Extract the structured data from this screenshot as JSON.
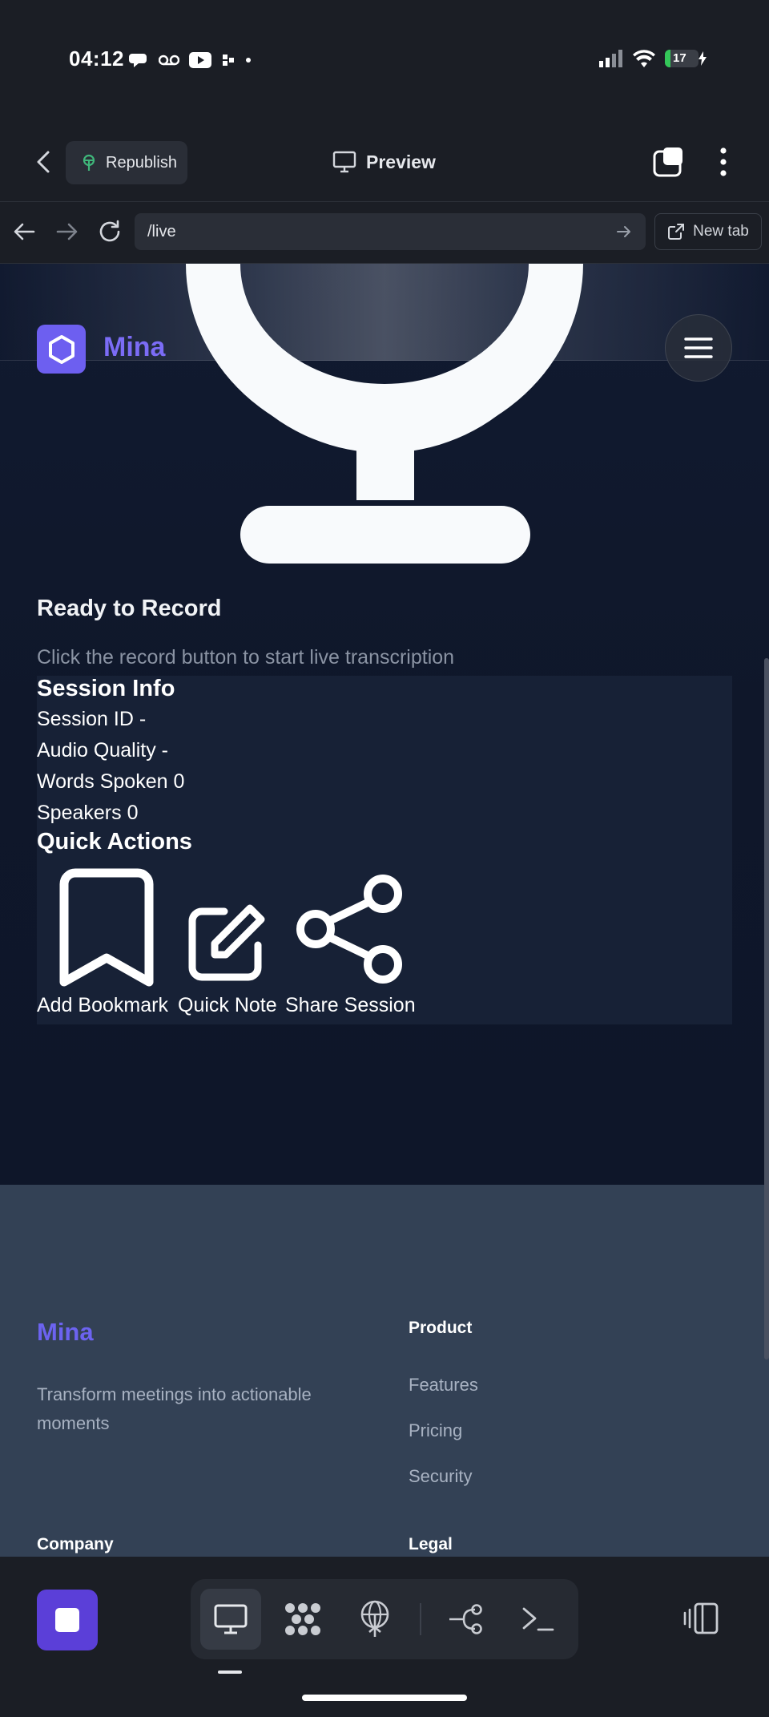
{
  "status_bar": {
    "time": "04:12",
    "battery": "17"
  },
  "app_header": {
    "republish_label": "Republish",
    "preview_label": "Preview"
  },
  "browser": {
    "url": "/live",
    "new_tab_label": "New tab"
  },
  "site": {
    "brand": "Mina",
    "recorder": {
      "title": "Ready to Record",
      "subtitle": "Click the record button to start live transcription"
    },
    "session_info": {
      "heading": "Session Info",
      "rows": [
        {
          "label": "Session ID",
          "value": "-"
        },
        {
          "label": "Audio Quality",
          "value": "-"
        },
        {
          "label": "Words Spoken",
          "value": "0"
        },
        {
          "label": "Speakers",
          "value": "0"
        }
      ]
    },
    "quick_actions": {
      "heading": "Quick Actions",
      "items": [
        {
          "label": "Add Bookmark",
          "icon": "bookmark-icon"
        },
        {
          "label": "Quick Note",
          "icon": "edit-icon"
        },
        {
          "label": "Share Session",
          "icon": "share-icon"
        }
      ]
    },
    "footer": {
      "brand": "Mina",
      "tagline": "Transform meetings into actionable moments",
      "product_heading": "Product",
      "product_links": [
        "Features",
        "Pricing",
        "Security"
      ],
      "company_heading": "Company",
      "legal_heading": "Legal"
    }
  },
  "colors": {
    "accent": "#6d5ff0",
    "page_bg": "#0f172a",
    "footer_bg": "#334155",
    "stop_button": "#5b3fd8"
  }
}
